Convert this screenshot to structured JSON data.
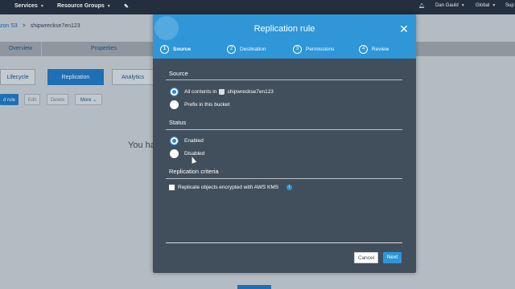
{
  "topbar": {
    "services": "Services",
    "resource_groups": "Resource Groups",
    "pin_icon": "pin-icon",
    "bell_icon": "bell-icon",
    "user": "Dan Gauld",
    "region": "Global",
    "support": "Sup"
  },
  "background": {
    "breadcrumb_root": "zon S3",
    "breadcrumb_sep": ">",
    "breadcrumb_bucket": "shipwreckse7en123",
    "tabs": [
      "Overview",
      "Properties"
    ],
    "subtabs": [
      "Lifecycle",
      "Replication",
      "Analytics"
    ],
    "buttons": [
      "d rule",
      "Edit",
      "Delete",
      "More"
    ],
    "message_start": "You ha"
  },
  "modal": {
    "title": "Replication rule",
    "close_icon": "close-icon",
    "steps": [
      {
        "num": "1",
        "label": "Source"
      },
      {
        "num": "2",
        "label": "Destination"
      },
      {
        "num": "3",
        "label": "Permissions"
      },
      {
        "num": "4",
        "label": "Review"
      }
    ],
    "source": {
      "heading": "Source",
      "all_contents_prefix": "All contents in",
      "bucket_name": "shipwreckse7en123",
      "prefix_option": "Prefix in this bucket"
    },
    "status": {
      "heading": "Status",
      "enabled": "Enabled",
      "disabled": "Disabled"
    },
    "criteria": {
      "heading": "Replication criteria",
      "kms_label": "Replicate objects encrypted with AWS KMS"
    },
    "buttons": {
      "cancel": "Cancel",
      "next": "Next"
    }
  },
  "colors": {
    "header_blue": "#2f96d8",
    "modal_bg": "#414f5c",
    "nav_bg": "#232f3e"
  }
}
